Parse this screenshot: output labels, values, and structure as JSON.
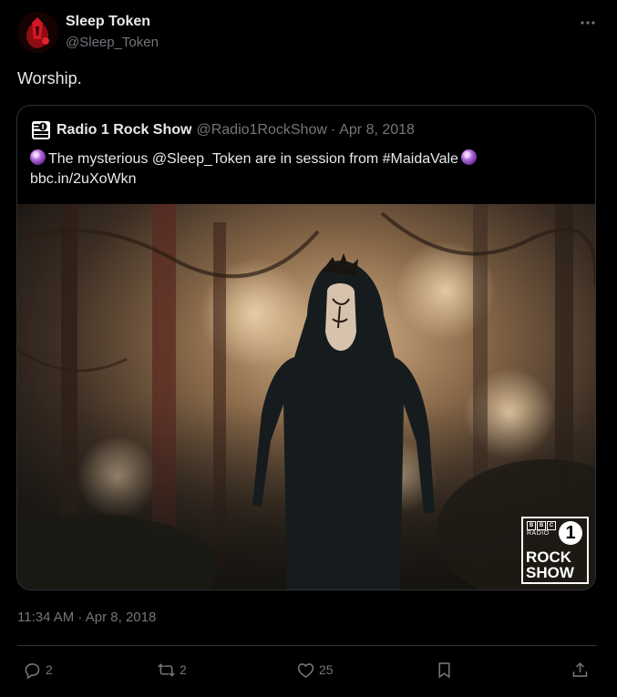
{
  "author": {
    "name": "Sleep Token",
    "handle": "@Sleep_Token"
  },
  "tweet": {
    "text": "Worship.",
    "timestamp": "11:34 AM · Apr 8, 2018"
  },
  "quoted": {
    "name": "Radio 1 Rock Show",
    "handle": "@Radio1RockShow",
    "separator": "·",
    "date": "Apr 8, 2018",
    "text_pre": "The mysterious ",
    "mention": "@Sleep_Token",
    "text_mid": " are in session from ",
    "hashtag": "#MaidaVale",
    "link": "bbc.in/2uXoWkn",
    "image_logo": {
      "bbc": [
        "B",
        "B",
        "C"
      ],
      "radio": "RADIO",
      "number": "1",
      "line1": "ROCK",
      "line2": "SHOW"
    }
  },
  "actions": {
    "reply_count": "2",
    "retweet_count": "2",
    "like_count": "25"
  },
  "colors": {
    "background": "#000000",
    "text": "#e7e9ea",
    "muted": "#71767b",
    "border": "#2f3336"
  }
}
